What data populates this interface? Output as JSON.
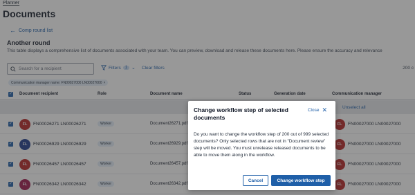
{
  "breadcrumb": "Planner",
  "page_title": "Documents",
  "back_link": "Comp round list",
  "section": {
    "title": "Another round",
    "description": "This table displays a comprehensive list of documents associated with your team. You can preview, download and release these documents here. Please ensure the accuracy and relevance"
  },
  "search": {
    "placeholder": "Search for a recipient"
  },
  "filters": {
    "label": "Filters",
    "count": "1",
    "clear_label": "Clear filters"
  },
  "count_right": "200 c",
  "filter_chip": {
    "label": "Communication manager name: FN00027000 LN00027000",
    "remove": "×"
  },
  "table": {
    "headers": {
      "recipient": "Document recipient",
      "role": "Role",
      "document_name": "Document name",
      "status": "Status",
      "generation_date": "Generation date",
      "comm_manager": "Communication manager"
    },
    "unselect_all": "Unselect all",
    "rows": [
      {
        "initials": "FL",
        "avatar_color": "#b42323",
        "recipient": "FN00026271 LN00026271",
        "role": "Worker",
        "document": "Document26271.pdf",
        "cm_initials": "FL",
        "cm_name": "FN00027000 LN00027000"
      },
      {
        "initials": "FL",
        "avatar_color": "#1e3a8a",
        "recipient": "FN00026929 LN00026929",
        "role": "Worker",
        "document": "Document26929.pdf",
        "cm_initials": "FL",
        "cm_name": "FN00027000 LN00027000"
      },
      {
        "initials": "FL",
        "avatar_color": "#b42323",
        "recipient": "FN00026457 LN00026457",
        "role": "Worker",
        "document": "Document26457.pdf",
        "cm_initials": "FL",
        "cm_name": "FN00027000 LN00027000"
      },
      {
        "initials": "FL",
        "avatar_color": "#9d174d",
        "recipient": "FN00026342 LN00026342",
        "role": "Worker",
        "document": "Document26342.pdf",
        "cm_initials": "FL",
        "cm_name": "FN00027000 LN00027000"
      }
    ]
  },
  "modal": {
    "title": "Change workflow step of selected documents",
    "close_label": "Close",
    "body": "Do you want to change the workflow step of 200 out of 999 selected documents? Only selected rows that are not in \"Document review\" step will be moved. You must unrelease released documents to be able to move them along in the workflow.",
    "cancel_label": "Cancel",
    "confirm_label": "Change workflow step"
  },
  "colors": {
    "accent": "#1f5fa8",
    "cm_avatar": "#b42323"
  }
}
